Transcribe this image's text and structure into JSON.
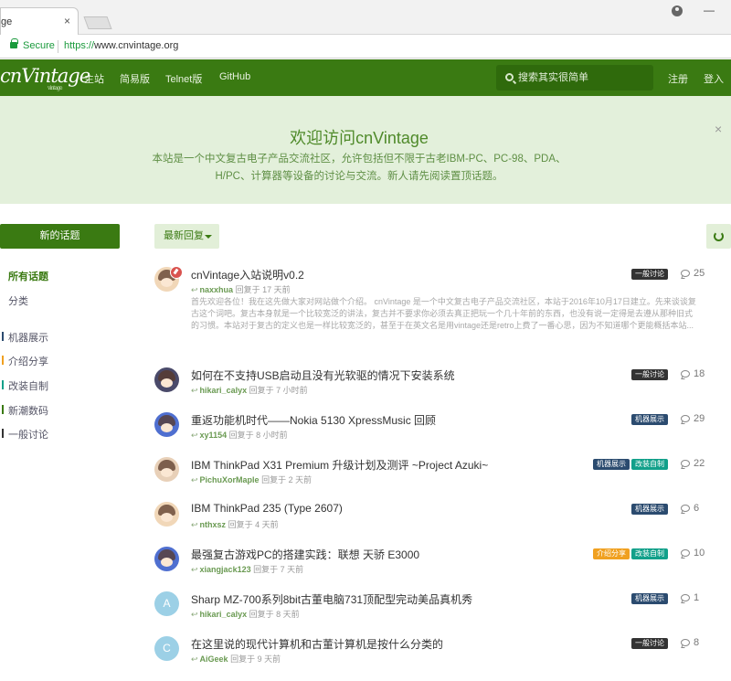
{
  "browser": {
    "tab_title": "ge",
    "tab_close": "×",
    "secure_label": "Secure",
    "url_proto": "https://",
    "url_host": "www.cnvintage.org"
  },
  "nav": {
    "logo": "cnVintage",
    "logo_small": "vintage",
    "links": [
      "主站",
      "简易版",
      "Telnet版",
      "GitHub"
    ],
    "search_placeholder": "搜索其实很简单",
    "register": "注册",
    "login": "登入"
  },
  "hero": {
    "title": "欢迎访问cnVintage",
    "desc": "本站是一个中文复古电子产品交流社区，允许包括但不限于古老IBM-PC、PC-98、PDA、H/PC、计算器等设备的讨论与交流。新人请先阅读置顶话题。",
    "close": "×"
  },
  "sidebar": {
    "new_button": "新的话题",
    "all": "所有话题",
    "tags_link": "分类",
    "tags": [
      {
        "label": "机器展示",
        "color": "#2b4b6f"
      },
      {
        "label": "介绍分享",
        "color": "#f0a020"
      },
      {
        "label": "改装自制",
        "color": "#12a08a"
      },
      {
        "label": "新潮数码",
        "color": "#3a7a12"
      },
      {
        "label": "一般讨论",
        "color": "#333333"
      }
    ]
  },
  "toolbar": {
    "sort": "最新回复"
  },
  "discussions": [
    {
      "title": "cnVintage入站说明v0.2",
      "user": "naxxhua",
      "time": "回复于 17 天前",
      "tags": [
        "一般讨论"
      ],
      "count": "25",
      "pinned": true,
      "excerpt": "首先欢迎各位！我在这先做大家对网站做个介绍。 cnVintage 是一个中文复古电子产品交流社区，本站于2016年10月17日建立。先来谈谈复古这个词吧。复古本身就是一个比较宽泛的讲法，复古并不要求你必须去真正把玩一个几十年前的东西，也没有说一定得是去遵从那种旧式的习惯。本站对于复古的定义也是一样比较宽泛的，甚至于在英文名是用vintage还是retro上费了一番心思，因为不知道哪个更能概括本站..."
    },
    {
      "title": "如何在不支持USB启动且没有光软驱的情况下安装系统",
      "user": "hikari_calyx",
      "time": "回复于 7 小时前",
      "tags": [
        "一般讨论"
      ],
      "count": "18"
    },
    {
      "title": "重返功能机时代——Nokia 5130 XpressMusic 回顾",
      "user": "xy1154",
      "time": "回复于 8 小时前",
      "tags": [
        "机器展示"
      ],
      "count": "29"
    },
    {
      "title": "IBM ThinkPad X31 Premium 升级计划及测评 ~Project Azuki~",
      "user": "PichuXorMaple",
      "time": "回复于 2 天前",
      "tags": [
        "机器展示",
        "改装自制"
      ],
      "count": "22"
    },
    {
      "title": "IBM ThinkPad 235 (Type 2607)",
      "user": "nthxsz",
      "time": "回复于 4 天前",
      "tags": [
        "机器展示"
      ],
      "count": "6"
    },
    {
      "title": "最强复古游戏PC的搭建实践：联想 天骄 E3000",
      "user": "xiangjack123",
      "time": "回复于 7 天前",
      "tags": [
        "介绍分享",
        "改装自制"
      ],
      "count": "10"
    },
    {
      "title": "Sharp MZ-700系列8bit古董电脑731顶配型完动美品真机秀",
      "user": "hikari_calyx",
      "time": "回复于 8 天前",
      "tags": [
        "机器展示"
      ],
      "count": "1",
      "letter": "A"
    },
    {
      "title": "在这里说的现代计算机和古董计算机是按什么分类的",
      "user": "AiGeek",
      "time": "回复于 9 天前",
      "tags": [
        "一般讨论"
      ],
      "count": "8",
      "letter": "C"
    }
  ],
  "reply_glyph": "↩"
}
